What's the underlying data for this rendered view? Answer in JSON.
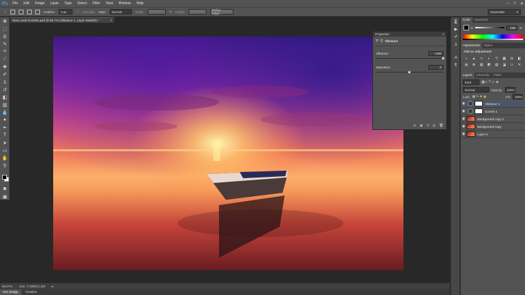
{
  "app": {
    "logo": "Ps"
  },
  "menu": [
    "File",
    "Edit",
    "Image",
    "Layer",
    "Type",
    "Select",
    "Filter",
    "View",
    "Window",
    "Help"
  ],
  "window_controls": [
    "–",
    "□",
    "✕"
  ],
  "options": {
    "feather_label": "Feather:",
    "feather_value": "0 px",
    "antialias_label": "Anti-alias",
    "style_label": "Style:",
    "style_value": "Normal",
    "width_label": "Width:",
    "height_label": "Height:",
    "refine_edge": "Refine Edge...",
    "workspace": "Essentials"
  },
  "document": {
    "tab_title": "New Level Sunsets.psd @ 66.7% (Vibrance 1, Layer Mask/8) *",
    "close": "×"
  },
  "status": {
    "zoom": "66.67%",
    "doc": "Doc: 7.03M/21.1M"
  },
  "bottom_tabs": [
    "Mini Bridge",
    "Timeline"
  ],
  "properties": {
    "title": "Properties",
    "panel_name": "Vibrance",
    "vibrance_label": "Vibrance:",
    "vibrance_value": "+100",
    "vibrance_level": 1.0,
    "saturation_label": "Saturation:",
    "saturation_value": "0",
    "saturation_level": 0.5
  },
  "color_panel": {
    "tabs": [
      "Color",
      "Swatches"
    ],
    "channel_label": "K",
    "value": "100",
    "unit": "%"
  },
  "adjustments": {
    "tabs": [
      "Adjustments",
      "Styles"
    ],
    "heading": "Add an adjustment"
  },
  "layers_panel": {
    "tabs": [
      "Layers",
      "Channels",
      "Paths"
    ],
    "kind": "Kind",
    "blend_mode": "Normal",
    "opacity_label": "Opacity:",
    "opacity_value": "100%",
    "lock_label": "Lock:",
    "fill_label": "Fill:",
    "fill_value": "100%",
    "layers": [
      {
        "name": "Vibrance 1",
        "type": "adjustment",
        "selected": true
      },
      {
        "name": "Curves 1",
        "type": "adjustment",
        "selected": false
      },
      {
        "name": "Background copy 2",
        "type": "image",
        "selected": false
      },
      {
        "name": "Background copy",
        "type": "image",
        "selected": false
      },
      {
        "name": "Layer 0",
        "type": "image",
        "selected": false
      }
    ]
  },
  "colors": {
    "accent": "#2fa3e6",
    "panel": "#535353",
    "bg": "#282828"
  }
}
